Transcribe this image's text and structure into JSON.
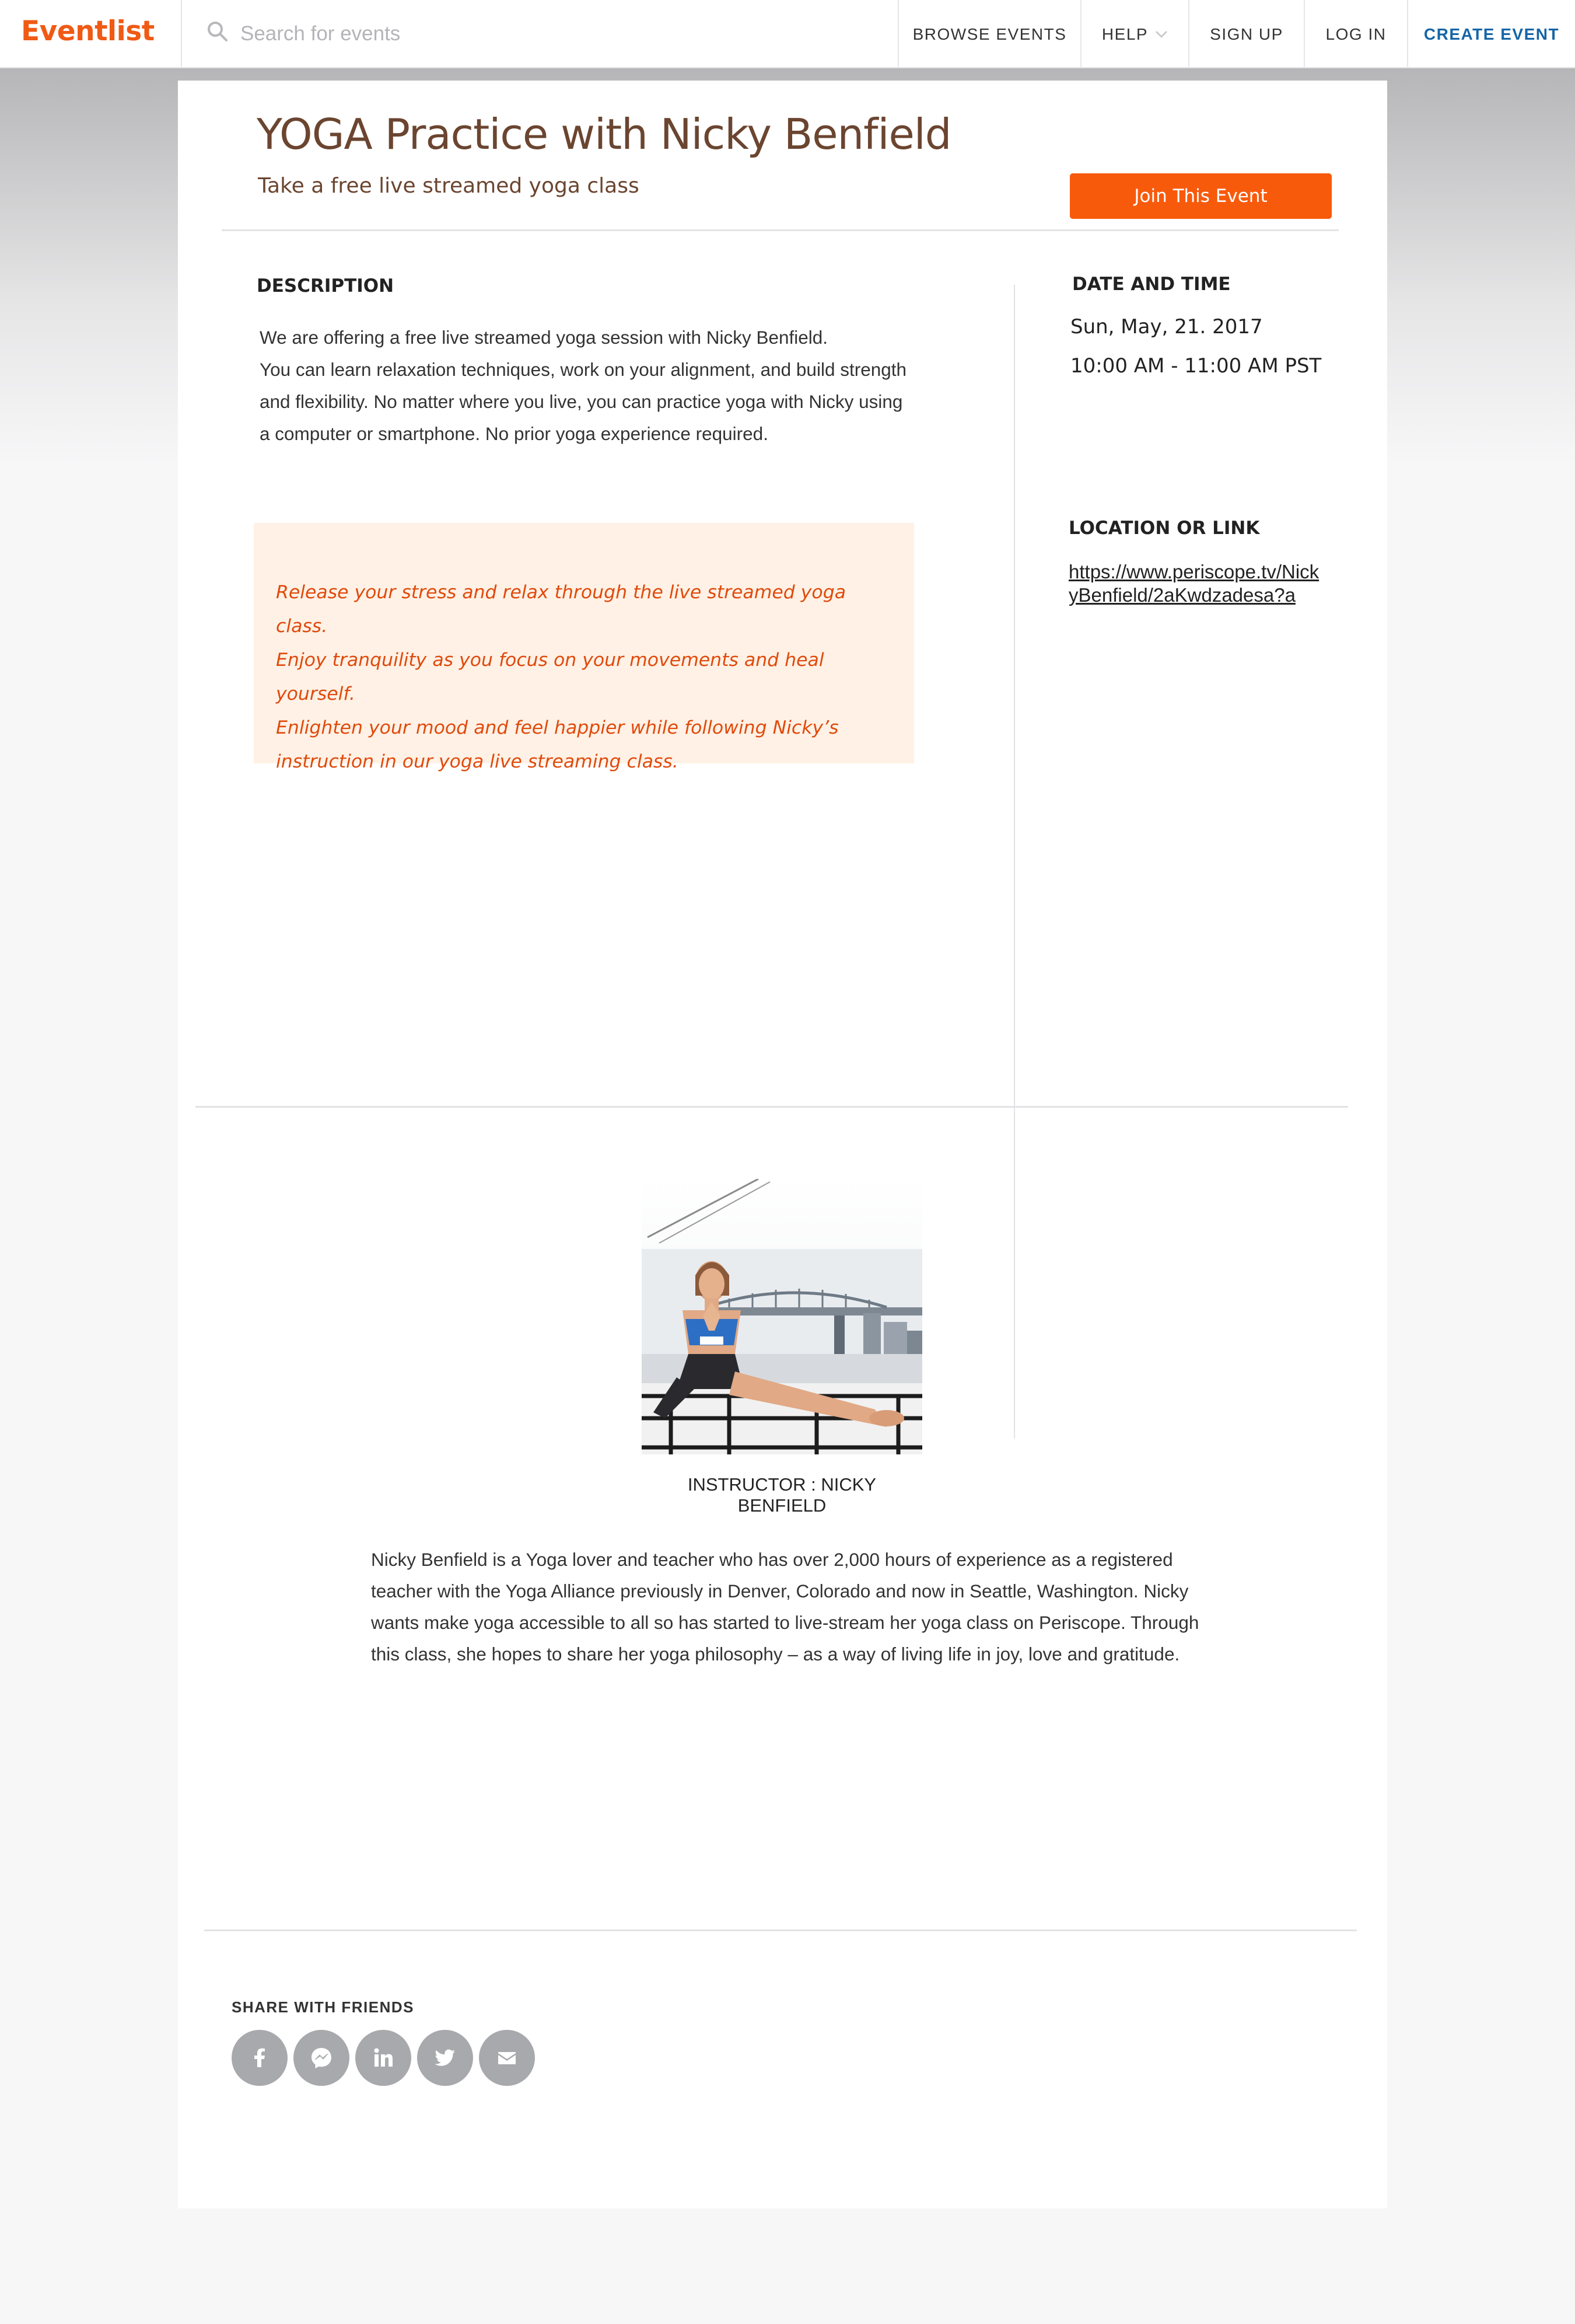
{
  "header": {
    "logo": "Eventlist",
    "search_placeholder": "Search for events",
    "nav": {
      "browse": "BROWSE EVENTS",
      "help": "HELP",
      "signup": "SIGN UP",
      "login": "LOG IN",
      "create": "CREATE EVENT"
    }
  },
  "event": {
    "title": "YOGA Practice with Nicky Benfield",
    "subtitle": "Take a free live streamed yoga class",
    "join_label": "Join This Event",
    "description_heading": "DESCRIPTION",
    "description_lines": [
      "We are offering a free live streamed yoga session with Nicky Benfield.",
      "You can learn relaxation techniques, work on your alignment, and build strength",
      "and flexibility. No matter where you live, you can practice yoga with Nicky  using",
      "a computer or smartphone. No prior yoga experience required."
    ],
    "quote_lines": [
      "Release your stress and relax through the live streamed yoga class.",
      "Enjoy tranquility as you focus on your movements  and heal yourself.",
      "Enlighten your mood and feel happier while following Nicky’s",
      "instruction in our yoga live streaming class."
    ],
    "datetime_heading": "DATE AND TIME",
    "date": "Sun, May, 21. 2017",
    "time": "10:00 AM - 11:00 AM PST",
    "location_heading": "LOCATION OR LINK",
    "location_link": "https://www.periscope.tv/NickyBenfield/2aKwdzadesa?a"
  },
  "instructor": {
    "caption": "INSTRUCTOR : NICKY BENFIELD",
    "bio_lines": [
      "Nicky Benfield is a Yoga lover and teacher who has over 2,000 hours of experience as a registered",
      "teacher with the Yoga Alliance previously in Denver, Colorado and now in Seattle, Washington. Nicky",
      "wants make yoga accessible to all so has started to live-stream her yoga class on Periscope. Through",
      "this class, she hopes to share her yoga philosophy – as a way of living life in joy, love and gratitude."
    ]
  },
  "share": {
    "heading": "SHARE WITH FRIENDS",
    "icons": [
      "facebook-icon",
      "messenger-icon",
      "linkedin-icon",
      "twitter-icon",
      "email-icon"
    ]
  },
  "colors": {
    "brand": "#f05a14",
    "join_button": "#f85a0c",
    "title": "#6b4530",
    "quote_text": "#e04a0c",
    "quote_bg": "#fff1e5",
    "create_event": "#1565a8",
    "share_icon_bg": "#a8a9ad"
  }
}
